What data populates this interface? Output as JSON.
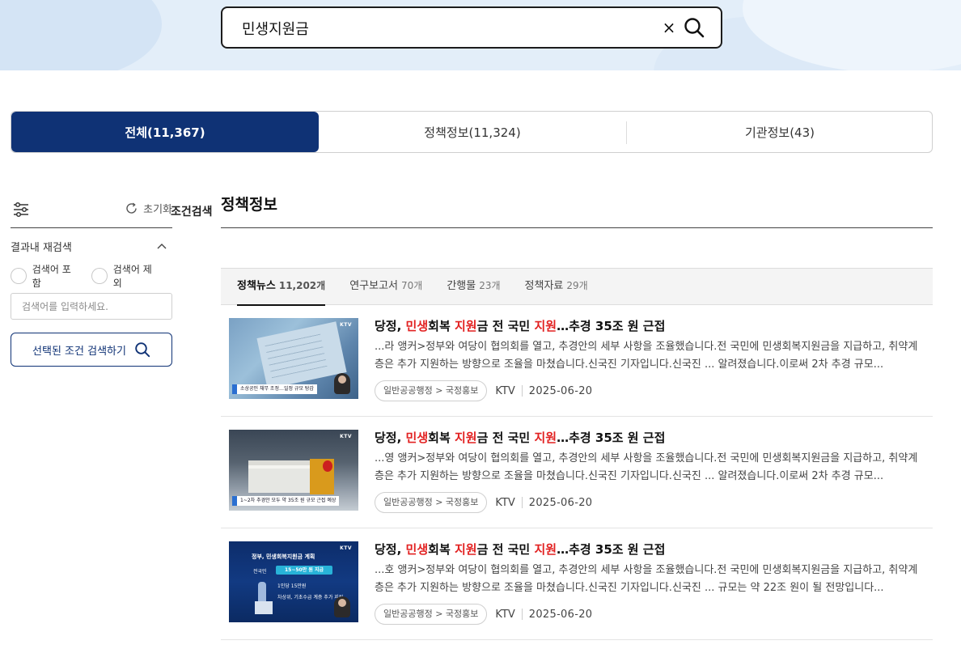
{
  "search": {
    "value": "민생지원금",
    "clear_symbol": "×"
  },
  "tabs": [
    {
      "label": "전체(11,367)",
      "active": true
    },
    {
      "label": "정책정보(11,324)",
      "active": false
    },
    {
      "label": "기관정보(43)",
      "active": false
    }
  ],
  "sidebar": {
    "title": "조건검색",
    "reset_label": "초기화",
    "refine_section": "결과내 재검색",
    "include_label": "검색어 포함",
    "exclude_label": "검색어 제외",
    "refine_placeholder": "검색어를 입력하세요.",
    "search_button": "선택된 조건 검색하기"
  },
  "main": {
    "section_title": "정책정보",
    "subtabs": [
      {
        "label": "정책뉴스",
        "count": "11,202개",
        "active": true
      },
      {
        "label": "연구보고서",
        "count": "70개",
        "active": false
      },
      {
        "label": "간행물",
        "count": "23개",
        "active": false
      },
      {
        "label": "정책자료",
        "count": "29개",
        "active": false
      }
    ],
    "results": [
      {
        "title_parts": [
          "당정, ",
          "민생",
          "회복 ",
          "지원",
          "금 전 국민 ",
          "지원",
          "…추경 35조 원 근접"
        ],
        "snippet": "...라 앵커>정부와 여당이 협의회를 열고, 추경안의 세부 사항을 조율했습니다.전 국민에 민생회복지원금을 지급하고, 취약계층은 추가 지원하는 방향으로 조율을 마쳤습니다.신국진 기자입니다.신국진 ... 알려졌습니다.이로써 2차 추경 규모...",
        "category": "일반공공행정 > 국정홍보",
        "source": "KTV",
        "date": "2025-06-20",
        "thumb_brand": "KTV",
        "thumb_caption": "소상공인 채무 조정…일정 규모 탕감"
      },
      {
        "title_parts": [
          "당정, ",
          "민생",
          "회복 ",
          "지원",
          "금 전 국민 ",
          "지원",
          "…추경 35조 원 근접"
        ],
        "snippet": "...영 앵커>정부와 여당이 협의회를 열고, 추경안의 세부 사항을 조율했습니다.전 국민에 민생회복지원금을 지급하고, 취약계층은 추가 지원하는 방향으로 조율을 마쳤습니다.신국진 기자입니다.신국진 ... 알려졌습니다.이로써 2차 추경 규모...",
        "category": "일반공공행정 > 국정홍보",
        "source": "KTV",
        "date": "2025-06-20",
        "thumb_brand": "KTV",
        "thumb_caption": "1~2차 추경안 모두 약 35조 원 규모 근접 예상"
      },
      {
        "title_parts": [
          "당정, ",
          "민생",
          "회복 ",
          "지원",
          "금 전 국민 ",
          "지원",
          "…추경 35조 원 근접"
        ],
        "snippet": "...호 앵커>정부와 여당이 협의회를 열고, 추경안의 세부 사항을 조율했습니다.전 국민에 민생회복지원금을 지급하고, 취약계층은 추가 지원하는 방향으로 조율을 마쳤습니다.신국진 기자입니다.신국진 ... 규모는 약 22조 원이 될 전망입니다...",
        "category": "일반공공행정 > 국정홍보",
        "source": "KTV",
        "date": "2025-06-20",
        "thumb_brand": "KTV",
        "thumb_heading": "정부, 민생회복지원금 계획",
        "thumb_pill": "15~50만 원 지급",
        "thumb_pill_prefix": "전국민",
        "thumb_line1": "1인당 15만원",
        "thumb_line2": "차상위, 기초수급 계층 추가 지원"
      }
    ]
  },
  "colors": {
    "accent_navy": "#0f3275",
    "highlight_red": "#e22121",
    "hero_bg": "#e3eef9"
  }
}
